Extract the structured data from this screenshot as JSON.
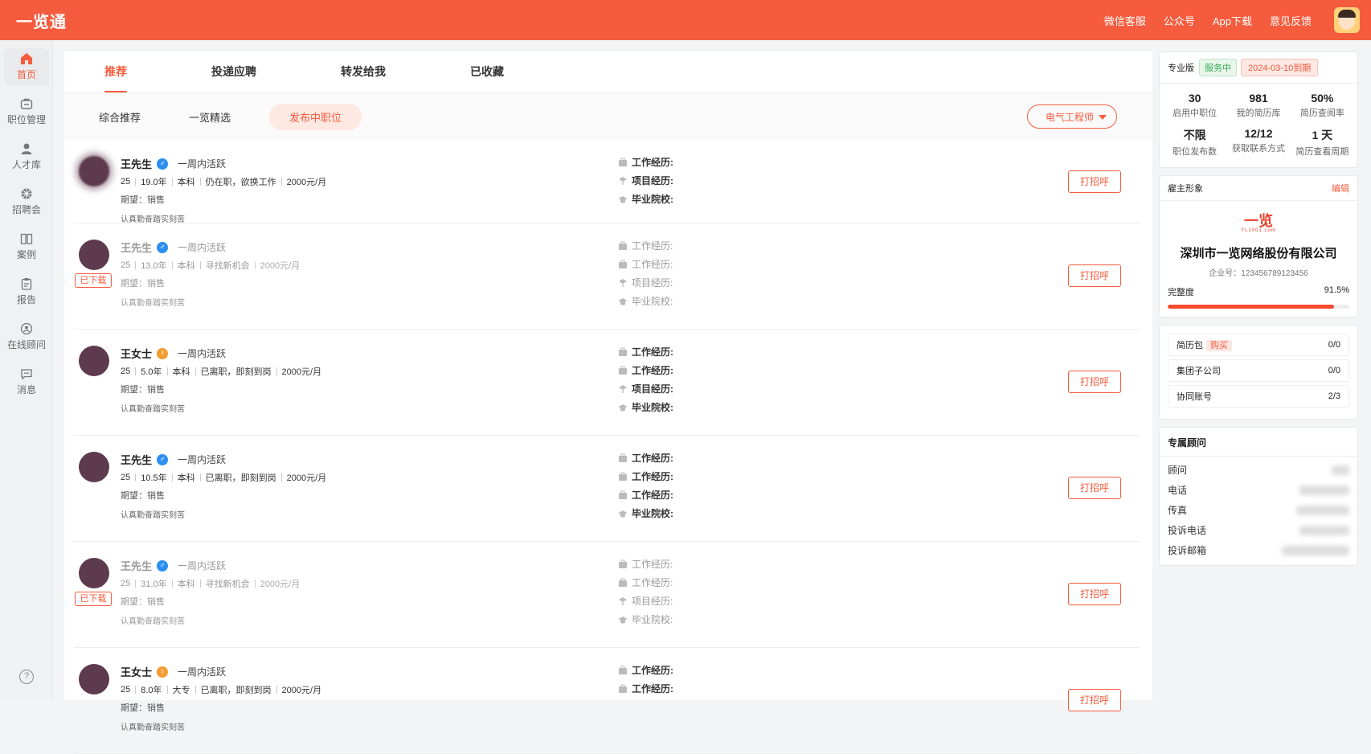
{
  "app": {
    "title": "一览通"
  },
  "topnav": {
    "items": [
      "微信客服",
      "公众号",
      "App下载",
      "意见反馈"
    ]
  },
  "sidebar": {
    "items": [
      {
        "label": "首页",
        "icon": "home-icon",
        "active": true
      },
      {
        "label": "职位管理",
        "icon": "briefcase-icon"
      },
      {
        "label": "人才库",
        "icon": "person-icon"
      },
      {
        "label": "招聘会",
        "icon": "fair-icon"
      },
      {
        "label": "案例",
        "icon": "book-icon"
      },
      {
        "label": "报告",
        "icon": "clipboard-icon"
      },
      {
        "label": "在线顾问",
        "icon": "advisor-icon"
      },
      {
        "label": "消息",
        "icon": "message-icon"
      }
    ],
    "help": "?"
  },
  "tabs": [
    "推荐",
    "投递应聘",
    "转发给我",
    "已收藏"
  ],
  "subtabs": [
    "综合推荐",
    "一览精选",
    "发布中职位"
  ],
  "job_select": "电气工程师",
  "candidates": [
    {
      "name": "王先生",
      "gender": "♂",
      "active": "一周内活跃",
      "age": "25",
      "years": "19.0年",
      "edu": "本科",
      "status": "仍在职，欲换工作",
      "salary": "2000元/月",
      "expect_label": "期望：",
      "expect": "销售",
      "motto": "认真勤奋踏实刻苦",
      "downloaded": false,
      "exp": [
        "工作经历:",
        "项目经历:",
        "毕业院校:"
      ],
      "button": "打招呼"
    },
    {
      "name": "王先生",
      "gender": "♂",
      "active": "一周内活跃",
      "age": "25",
      "years": "13.0年",
      "edu": "本科",
      "status": "寻找新机会",
      "salary": "2000元/月",
      "expect_label": "期望：",
      "expect": "销售",
      "motto": "认真勤奋踏实刻苦",
      "downloaded": true,
      "badge": "已下载",
      "exp": [
        "工作经历:",
        "工作经历:",
        "项目经历:",
        "毕业院校:"
      ],
      "button": "打招呼"
    },
    {
      "name": "王女士",
      "gender": "♀",
      "active": "一周内活跃",
      "age": "25",
      "years": "5.0年",
      "edu": "本科",
      "status": "已离职，即刻到岗",
      "salary": "2000元/月",
      "expect_label": "期望：",
      "expect": "销售",
      "motto": "认真勤奋踏实刻苦",
      "downloaded": false,
      "exp": [
        "工作经历:",
        "工作经历:",
        "项目经历:",
        "毕业院校:"
      ],
      "button": "打招呼"
    },
    {
      "name": "王先生",
      "gender": "♂",
      "active": "一周内活跃",
      "age": "25",
      "years": "10.5年",
      "edu": "本科",
      "status": "已离职，即刻到岗",
      "salary": "2000元/月",
      "expect_label": "期望：",
      "expect": "销售",
      "motto": "认真勤奋踏实刻苦",
      "downloaded": false,
      "exp": [
        "工作经历:",
        "工作经历:",
        "工作经历:",
        "毕业院校:"
      ],
      "button": "打招呼"
    },
    {
      "name": "王先生",
      "gender": "♂",
      "active": "一周内活跃",
      "age": "25",
      "years": "31.0年",
      "edu": "本科",
      "status": "寻找新机会",
      "salary": "2000元/月",
      "expect_label": "期望：",
      "expect": "销售",
      "motto": "认真勤奋踏实刻苦",
      "downloaded": true,
      "badge": "已下载",
      "exp": [
        "工作经历:",
        "工作经历:",
        "项目经历:",
        "毕业院校:"
      ],
      "button": "打招呼"
    },
    {
      "name": "王女士",
      "gender": "♀",
      "active": "一周内活跃",
      "age": "25",
      "years": "8.0年",
      "edu": "大专",
      "status": "已离职，即刻到岗",
      "salary": "2000元/月",
      "expect_label": "期望：",
      "expect": "销售",
      "motto": "认真勤奋踏实刻苦",
      "downloaded": false,
      "exp": [
        "工作经历:",
        "工作经历:"
      ],
      "button": "打招呼"
    }
  ],
  "plan": {
    "name": "专业版",
    "status": "服务中",
    "expiry": "2024-03-10到期",
    "stats": [
      {
        "value": "30",
        "label": "启用中职位"
      },
      {
        "value": "981",
        "label": "我的简历库"
      },
      {
        "value": "50%",
        "label": "简历查阅率"
      },
      {
        "value": "不限",
        "label": "职位发布数"
      },
      {
        "value": "12/12",
        "label": "获取联系方式"
      },
      {
        "value": "1 天",
        "label": "简历查看周期"
      }
    ]
  },
  "employer": {
    "title": "雇主形象",
    "edit": "编辑",
    "logo_text": "一览",
    "logo_sub": "YL1001.com",
    "company": "深圳市一览网络股份有限公司",
    "company_id": "企业号：123456789123456",
    "completeness_label": "完整度",
    "completeness": "91.5%",
    "completeness_value": 0.915
  },
  "packages": [
    {
      "label": "简历包",
      "buy": "购买",
      "value": "0/0"
    },
    {
      "label": "集团子公司",
      "value": "0/0"
    },
    {
      "label": "协同账号",
      "value": "2/3"
    }
  ],
  "advisor": {
    "title": "专属顾问",
    "rows": [
      "顾问",
      "电话",
      "传真",
      "投诉电话",
      "投诉邮箱"
    ]
  },
  "colors": {
    "brand": "#f55b3d",
    "male": "#2b8ef2",
    "female": "#f39c30"
  }
}
